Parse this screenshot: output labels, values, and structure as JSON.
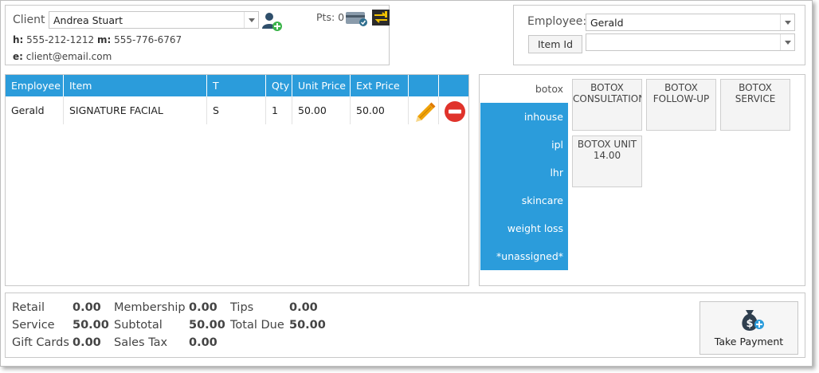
{
  "client": {
    "label": "Client",
    "name": "Andrea Stuart",
    "points_label": "Pts: 0",
    "home_label": "h:",
    "home_phone": "555-212-1212",
    "mobile_label": "m:",
    "mobile_phone": "555-776-6767",
    "email_label": "e:",
    "email": "client@email.com"
  },
  "employee": {
    "label": "Employee:",
    "selected": "Gerald",
    "item_id_label": "Item Id",
    "item_id_value": ""
  },
  "table": {
    "headers": [
      "Employee",
      "Item",
      "T",
      "Qty",
      "Unit Price",
      "Ext Price",
      "",
      ""
    ],
    "rows": [
      {
        "employee": "Gerald",
        "item": "SIGNATURE FACIAL",
        "type": "S",
        "qty": "1",
        "unit_price": "50.00",
        "ext_price": "50.00"
      }
    ]
  },
  "categories": [
    {
      "label": "botox",
      "active": false
    },
    {
      "label": "inhouse",
      "active": true
    },
    {
      "label": "ipl",
      "active": true
    },
    {
      "label": "lhr",
      "active": true
    },
    {
      "label": "skincare",
      "active": true
    },
    {
      "label": "weight loss",
      "active": true
    },
    {
      "label": "*unassigned*",
      "active": true
    }
  ],
  "products": [
    {
      "line1": "BOTOX",
      "line2": "CONSULTATION"
    },
    {
      "line1": "BOTOX",
      "line2": "FOLLOW-UP"
    },
    {
      "line1": "BOTOX",
      "line2": "SERVICE"
    },
    {
      "line1": "BOTOX UNIT",
      "line2": "14.00"
    }
  ],
  "totals": {
    "retail_label": "Retail",
    "retail": "0.00",
    "service_label": "Service",
    "service": "50.00",
    "gift_cards_label": "Gift Cards",
    "gift_cards": "0.00",
    "membership_label": "Membership",
    "membership": "0.00",
    "subtotal_label": "Subtotal",
    "subtotal": "50.00",
    "sales_tax_label": "Sales Tax",
    "sales_tax": "0.00",
    "tips_label": "Tips",
    "tips": "0.00",
    "total_due_label": "Total Due",
    "total_due": "50.00"
  },
  "actions": {
    "take_payment_label": "Take Payment"
  },
  "icons": {
    "add_client": "add-user-icon",
    "card": "credit-card-icon",
    "transfer": "transfer-icon",
    "edit": "pencil-icon",
    "delete": "delete-icon",
    "payment": "money-bag-icon"
  },
  "colors": {
    "accent": "#2b9cdb",
    "edit": "#f0a30a",
    "delete": "#e0332b"
  }
}
